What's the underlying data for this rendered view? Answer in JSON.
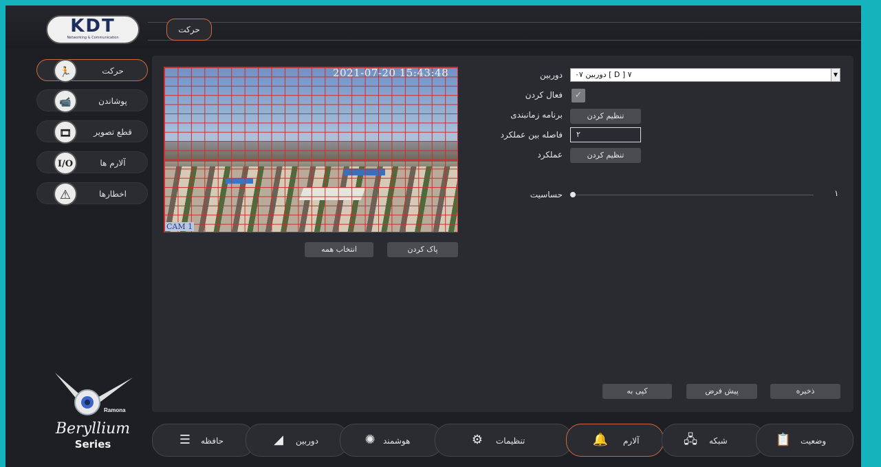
{
  "header": {
    "logo_text": "KDT",
    "logo_subtext": "Networking & Communication",
    "tab_label": "حرکت"
  },
  "sidebar": {
    "items": [
      {
        "label": "حرکت",
        "icon": "running-person-icon",
        "glyph": "🏃",
        "active": true
      },
      {
        "label": "پوشاندن",
        "icon": "camera-mask-icon",
        "glyph": "📹",
        "active": false
      },
      {
        "label": "قطع تصویر",
        "icon": "video-loss-icon",
        "glyph": "🎞",
        "active": false
      },
      {
        "label": "آلارم ها",
        "icon": "io-icon",
        "glyph": "I/O",
        "active": false
      },
      {
        "label": "اخطارها",
        "icon": "warning-icon",
        "glyph": "⚠",
        "active": false
      }
    ]
  },
  "video": {
    "timestamp": "2021-07-20 15:43:48",
    "camera_label": "CAM 1"
  },
  "video_buttons": {
    "clear": "پاک کردن",
    "select_all": "انتخاب همه"
  },
  "form": {
    "camera_label": "دوربین",
    "camera_value": "دوربین ۰۷ [ D ] ۷",
    "enable_label": "فعال کردن",
    "enable_checked": true,
    "schedule_label": "برنامه زمانبندی",
    "schedule_button": "تنظیم کردن",
    "interval_label": "فاصله بین عملکرد",
    "interval_value": "۲",
    "action_label": "عملکرد",
    "action_button": "تنظیم کردن",
    "sensitivity_label": "حساسیت",
    "sensitivity_value": "۱"
  },
  "footer_buttons": {
    "copy": "کپی به",
    "default": "پیش فرض",
    "save": "ذخیره"
  },
  "branding": {
    "mascot_text": "Ramona",
    "series_title": "Beryllium",
    "series_subtitle": "Series"
  },
  "bottom_nav": [
    {
      "label": "حافظه",
      "icon": "storage-icon",
      "glyph": "☰",
      "active": false
    },
    {
      "label": "دوربین",
      "icon": "camera-icon",
      "glyph": "◢",
      "active": false
    },
    {
      "label": "هوشمند",
      "icon": "smart-bulb-icon",
      "glyph": "✺",
      "active": false
    },
    {
      "label": "تنظیمات",
      "icon": "gears-icon",
      "glyph": "⚙",
      "active": false
    },
    {
      "label": "آلارم",
      "icon": "alarm-bell-icon",
      "glyph": "🔔",
      "active": true
    },
    {
      "label": "شبکه",
      "icon": "network-icon",
      "glyph": "🖧",
      "active": false
    },
    {
      "label": "وضعیت",
      "icon": "status-clipboard-icon",
      "glyph": "📋",
      "active": false
    }
  ],
  "colors": {
    "accent": "#d06a3a",
    "grid_line": "#d32a2a",
    "outer_bg": "#15b3bb"
  }
}
